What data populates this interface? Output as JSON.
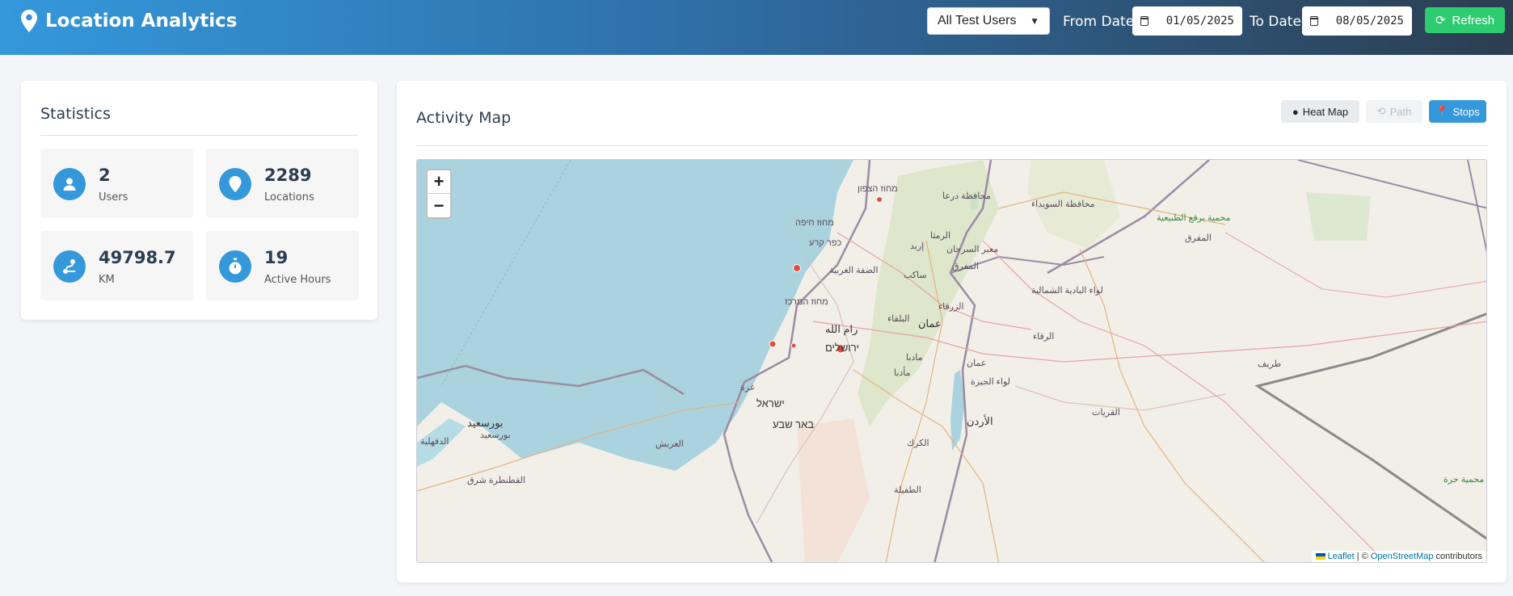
{
  "header": {
    "title": "Location Analytics",
    "icon": "map-pin-icon",
    "user_filter": "All Test Users",
    "from_label": "From Date:",
    "from_date": "01/05/2025",
    "to_label": "To Date:",
    "to_date": "08/05/2025",
    "refresh_label": "Refresh",
    "accent": "#2ecc71"
  },
  "statistics": {
    "title": "Statistics",
    "items": [
      {
        "value": "2",
        "label": "Users",
        "icon": "user-icon"
      },
      {
        "value": "2289",
        "label": "Locations",
        "icon": "map-marker-icon"
      },
      {
        "value": "49798.7",
        "label": "KM",
        "icon": "route-icon"
      },
      {
        "value": "19",
        "label": "Active Hours",
        "icon": "stopwatch-icon"
      }
    ]
  },
  "map_panel": {
    "title": "Activity Map",
    "toggles": [
      {
        "label": "Heat Map",
        "icon": "fire-icon",
        "state": "inactive"
      },
      {
        "label": "Path",
        "icon": "route-icon",
        "state": "disabled"
      },
      {
        "label": "Stops",
        "icon": "pin-icon",
        "state": "active"
      }
    ],
    "zoom_in": "+",
    "zoom_out": "−",
    "attribution": {
      "leaflet": "Leaflet",
      "sep": " | © ",
      "osm": "OpenStreetMap",
      "suffix": " contributors"
    },
    "place_labels": [
      "מחוז הצפון",
      "محافظة درعا",
      "محافظة السويداء",
      "محمية برقع الطبيعية",
      "المفرق",
      "מחוז חיפה",
      "כפר קרע",
      "الرمثا",
      "إربد",
      "معبر السرحان",
      "الضفة الغربية",
      "ساكب",
      "المفرق",
      "لواء البادية الشمالية",
      "מחוז המרכז",
      "البلقاء",
      "الزرقاء",
      "رام الله",
      "عمان",
      "ירושלים",
      "الرقاء",
      "مادبا",
      "مأدبا",
      "عمان",
      "لواء الجيزة",
      "غزة",
      "ישראל",
      "באר שבע",
      "الأردن",
      "بورسعيد",
      "بورسعيد",
      "الدقهلية",
      "العريش",
      "الكرك",
      "القطنطرة شرق",
      "الطفيلة",
      "القريات",
      "طريف",
      "محمية حرة"
    ]
  }
}
